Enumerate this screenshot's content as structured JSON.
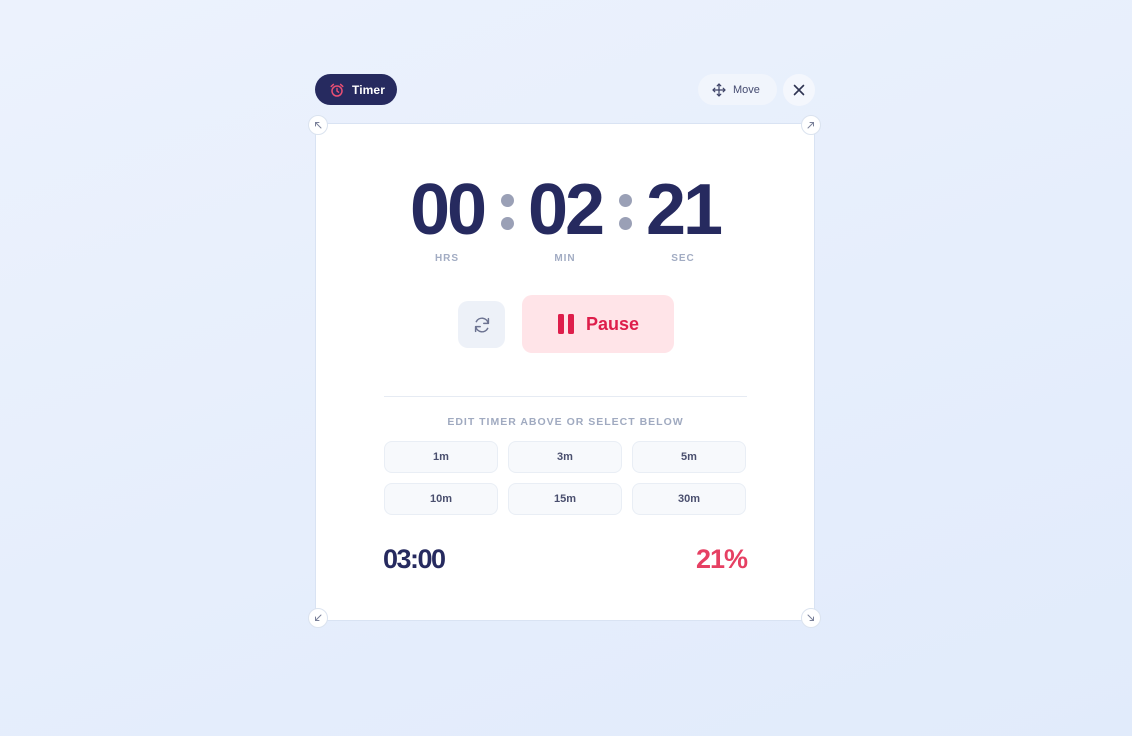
{
  "header": {
    "title": "Timer",
    "move_label": "Move"
  },
  "timer": {
    "hours": "00",
    "minutes": "02",
    "seconds": "21",
    "labels": {
      "hours": "HRS",
      "minutes": "MIN",
      "seconds": "SEC"
    }
  },
  "controls": {
    "pause_label": "Pause"
  },
  "presets": {
    "hint": "EDIT TIMER ABOVE OR SELECT BELOW",
    "items": [
      "1m",
      "3m",
      "5m",
      "10m",
      "15m",
      "30m"
    ]
  },
  "footer": {
    "total": "03:00",
    "progress": "21%"
  },
  "colors": {
    "primary": "#262a5f",
    "accent": "#de1e4b",
    "pause_bg": "#ffe4e8",
    "progress": "#e64063"
  },
  "icons": {
    "title": "alarm-clock-icon",
    "move": "move-arrows-icon",
    "close": "close-icon",
    "reset": "refresh-icon",
    "pause": "pause-icon"
  }
}
